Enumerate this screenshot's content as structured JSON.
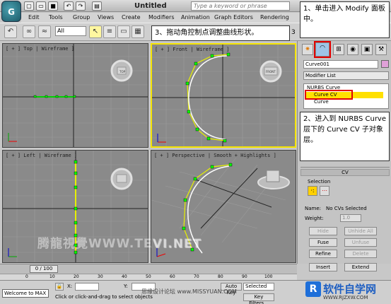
{
  "title_bar": {
    "title": "Untitled",
    "search_placeholder": "Type a keyword or phrase",
    "logo_letter": "G"
  },
  "menu": [
    "Edit",
    "Tools",
    "Group",
    "Views",
    "Create",
    "Modifiers",
    "Animation",
    "Graph Editors",
    "Rendering"
  ],
  "toolbar": {
    "selection_filter": "All",
    "snap_label": "3"
  },
  "viewports": {
    "top": "[ + ] Top | Wireframe ]",
    "front": "[ + ] Front | Wireframe ]",
    "left": "[ + ] Left | Wireframe ]",
    "perspective": "[ + ] Perspective | Smooth + Highlights ]",
    "cube_top": "TOP",
    "cube_front": "FRONT",
    "cube_left": "LEFT"
  },
  "command_panel": {
    "object_name": "Curve001",
    "modifier_list": "Modifier List",
    "stack": [
      "NURBS Curve",
      "Curve CV",
      "Curve"
    ],
    "rollout_title": "CV",
    "selection_label": "Selection",
    "name_label": "Name:",
    "name_value": "No CVs Selected",
    "weight_label": "Weight:",
    "weight_value": "1.0",
    "buttons": {
      "hide": "Hide",
      "unhide_all": "Unhide All",
      "fuse": "Fuse",
      "unfuse": "Unfuse",
      "refine": "Refine",
      "delete": "Delete",
      "insert": "Insert",
      "extend": "Extend"
    }
  },
  "annotations": {
    "note1": "1、单击进入 Modify 面板中。",
    "note2": "2、进入到 NURBS Curve 层下的 Curve CV 子对象层。",
    "note3": "3、拖动角控制点调整曲线形状。"
  },
  "timeline": {
    "frame": "0 / 100",
    "ticks": [
      "0",
      "10",
      "20",
      "30",
      "40",
      "50",
      "60",
      "70",
      "80",
      "90",
      "100"
    ]
  },
  "status": {
    "maxscript": "Welcome to MAX",
    "prompt": "Click or click-and-drag to select objects",
    "x_label": "X:",
    "y_label": "Y:",
    "auto_key": "Auto Key",
    "selected": "Selected",
    "key_filters": "Key Filters..."
  },
  "watermarks": {
    "vp_watermark": "腾龍視覺WWW.TEVI.NET",
    "forum": "思缘设计论坛 www.MISSYUAN.COM",
    "logo": "软件自学网",
    "logo_url": "WWW.RJZXW.COM"
  },
  "colors": {
    "accent_yellow": "#f5e400",
    "curve_green": "#00d000",
    "highlight_red": "#e00000"
  }
}
